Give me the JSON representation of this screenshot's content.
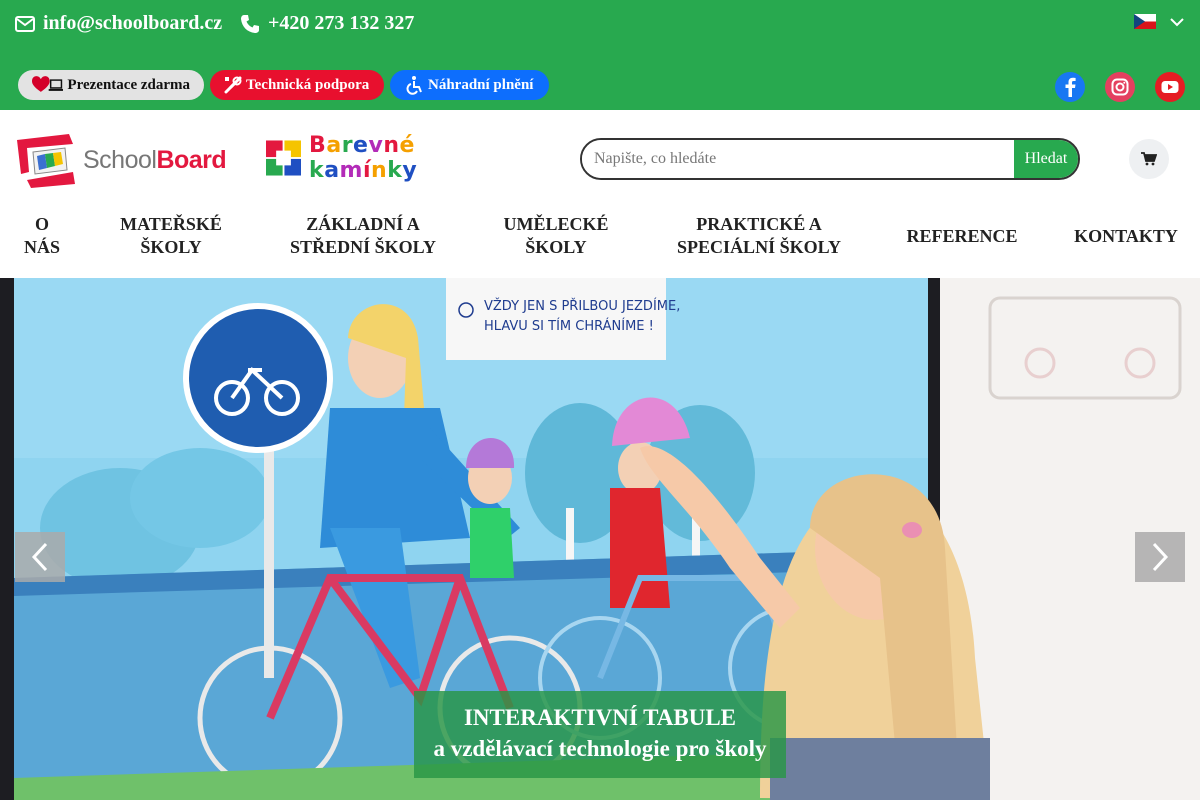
{
  "contact": {
    "email": "info@schoolboard.cz",
    "phone": "+420 273 132 327",
    "email_icon": "envelope-icon",
    "phone_icon": "phone-icon"
  },
  "language": {
    "flag": "czech-flag-icon",
    "chevron": "chevron-down-icon"
  },
  "quick_links": [
    {
      "label": "Prezentace zdarma",
      "icon": "heart-laptop-icon",
      "color": "#e3e3e3"
    },
    {
      "label": "Technická podpora",
      "icon": "tools-icon",
      "color": "#e8102e"
    },
    {
      "label": "Náhradní plnění",
      "icon": "wheelchair-icon",
      "color": "#0d6efd"
    }
  ],
  "social": [
    {
      "icon": "facebook-icon",
      "color": "#1877f2"
    },
    {
      "icon": "instagram-icon",
      "color": "#e4405f"
    },
    {
      "icon": "youtube-icon",
      "color": "#e51c23"
    }
  ],
  "logos": {
    "schoolboard": {
      "part1": "School",
      "part2": "Board"
    },
    "barevne": {
      "text": "Barevné kamínky"
    }
  },
  "search": {
    "placeholder": "Napište, co hledáte",
    "button": "Hledat"
  },
  "cart": {
    "icon": "cart-icon"
  },
  "nav": [
    {
      "label": "O\nNÁS"
    },
    {
      "label": "MATEŘSKÉ\nŠKOLY"
    },
    {
      "label": "ZÁKLADNÍ A\nSTŘEDNÍ ŠKOLY"
    },
    {
      "label": "UMĚLECKÉ\nŠKOLY"
    },
    {
      "label": "PRAKTICKÉ A\nSPECIÁLNÍ ŠKOLY"
    },
    {
      "label": "REFERENCE"
    },
    {
      "label": "KONTAKTY"
    }
  ],
  "hero": {
    "caption_line1": "INTERAKTIVNÍ TABULE",
    "caption_line2": "a vzdělávací technologie pro školy",
    "board_text_line1": "VŽDY JEN S PŘILBOU JEZDÍME,",
    "board_text_line2": "HLAVU SI TÍM CHRÁNÍME !",
    "prev_icon": "chevron-left-icon",
    "next_icon": "chevron-right-icon"
  },
  "colors": {
    "brand_green": "#28a94f",
    "brand_red": "#e3183f"
  }
}
